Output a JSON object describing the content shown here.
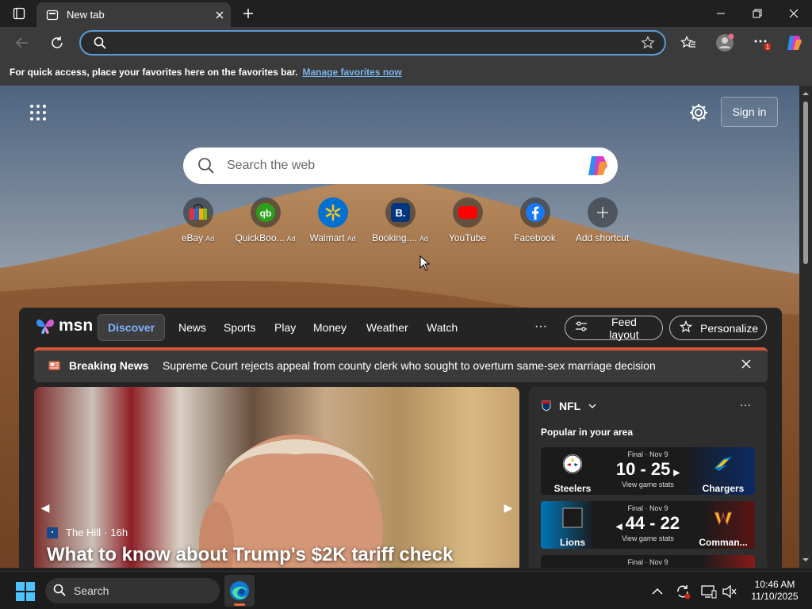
{
  "browser": {
    "tab_title": "New tab",
    "address_value": "",
    "address_placeholder": ""
  },
  "favorites_bar": {
    "hint": "For quick access, place your favorites here on the favorites bar.",
    "link": "Manage favorites now"
  },
  "ntp": {
    "signin_label": "Sign in",
    "search_placeholder": "Search the web",
    "shortcuts": [
      {
        "label": "eBay",
        "ad": "Ad"
      },
      {
        "label": "QuickBoo...",
        "ad": "Ad"
      },
      {
        "label": "Walmart",
        "ad": "Ad"
      },
      {
        "label": "Booking....",
        "ad": "Ad"
      },
      {
        "label": "YouTube",
        "ad": ""
      },
      {
        "label": "Facebook",
        "ad": ""
      },
      {
        "label": "Add shortcut",
        "ad": ""
      }
    ]
  },
  "feed": {
    "logo": "msn",
    "tabs": [
      "Discover",
      "News",
      "Sports",
      "Play",
      "Money",
      "Weather",
      "Watch"
    ],
    "more": "···",
    "feed_layout_label": "Feed layout",
    "personalize_label": "Personalize",
    "breaking": {
      "label": "Breaking News",
      "text": "Supreme Court rejects appeal from county clerk who sought to overturn same-sex marriage decision"
    },
    "hero": {
      "source": "The Hill",
      "age": "16h",
      "headline": "What to know about Trump's $2K tariff check"
    },
    "nfl": {
      "title": "NFL",
      "subtitle": "Popular in your area",
      "games": [
        {
          "status": "Final · Nov 9",
          "score": "10 - 25",
          "stats": "View game stats",
          "home": "Steelers",
          "away": "Chargers"
        },
        {
          "status": "Final · Nov 9",
          "score": "44 - 22",
          "stats": "View game stats",
          "home": "Lions",
          "away": "Comman..."
        },
        {
          "status": "Final · Nov 9",
          "score": "",
          "stats": "",
          "home": "",
          "away": ""
        }
      ]
    }
  },
  "taskbar": {
    "search_label": "Search",
    "time": "10:46 AM",
    "date": "11/10/2025"
  },
  "colors": {
    "accent": "#5b9bd5",
    "breaking": "#d4553a",
    "discover": "#7fb3ff"
  }
}
